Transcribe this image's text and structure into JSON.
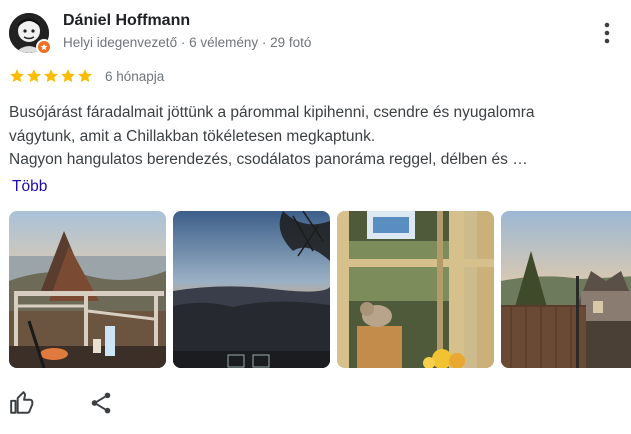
{
  "review": {
    "author_name": "Dániel Hoffmann",
    "author_meta": "Helyi idegenvezető · 6 vélemény · 29 fotó",
    "rating": 5,
    "rating_max": 5,
    "date": "6 hónapja",
    "text_lines": [
      "Busójárást fáradalmait jöttünk a párommal kipihenni, csendre és nyugalomra",
      "vágytunk, amit a Chillakban tökéletesen megkaptunk.",
      "Nagyon hangulatos berendezés, csodálatos panoráma reggel, délben és …"
    ],
    "more_label": "Több"
  },
  "icons": {
    "avatar_badge": "local-guide-badge-icon",
    "more_options": "more-vert-icon",
    "star": "star-icon",
    "like": "thumb-up-icon",
    "share": "share-icon"
  },
  "colors": {
    "star": "#fbbc04",
    "link": "#1a0dab",
    "badge": "#f36d21",
    "meta_text": "#70757a",
    "icon": "#5f6368"
  }
}
